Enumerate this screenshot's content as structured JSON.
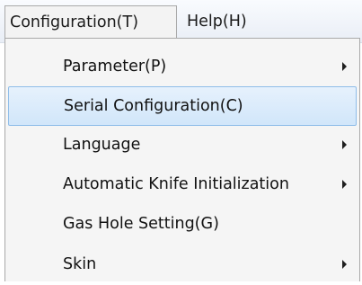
{
  "menubar": {
    "items": [
      {
        "label": "Configuration(T)",
        "state": "open"
      },
      {
        "label": "Help(H)"
      }
    ]
  },
  "dropdown": {
    "items": [
      {
        "label": "Parameter(P)",
        "submenu": true,
        "icon": "submenu-arrow-icon"
      },
      {
        "label": "Serial Configuration(C)",
        "submenu": false,
        "highlighted": true
      },
      {
        "label": "Language",
        "submenu": true,
        "icon": "submenu-arrow-icon"
      },
      {
        "label": "Automatic Knife Initialization",
        "submenu": true,
        "icon": "submenu-arrow-icon"
      },
      {
        "label": "Gas Hole Setting(G)",
        "submenu": false
      },
      {
        "label": "Skin",
        "submenu": true,
        "icon": "submenu-arrow-icon"
      }
    ]
  },
  "colors": {
    "highlight_fill": "#d9ebfb",
    "highlight_border": "#8fbde9",
    "menu_background": "#f5f5f5"
  }
}
